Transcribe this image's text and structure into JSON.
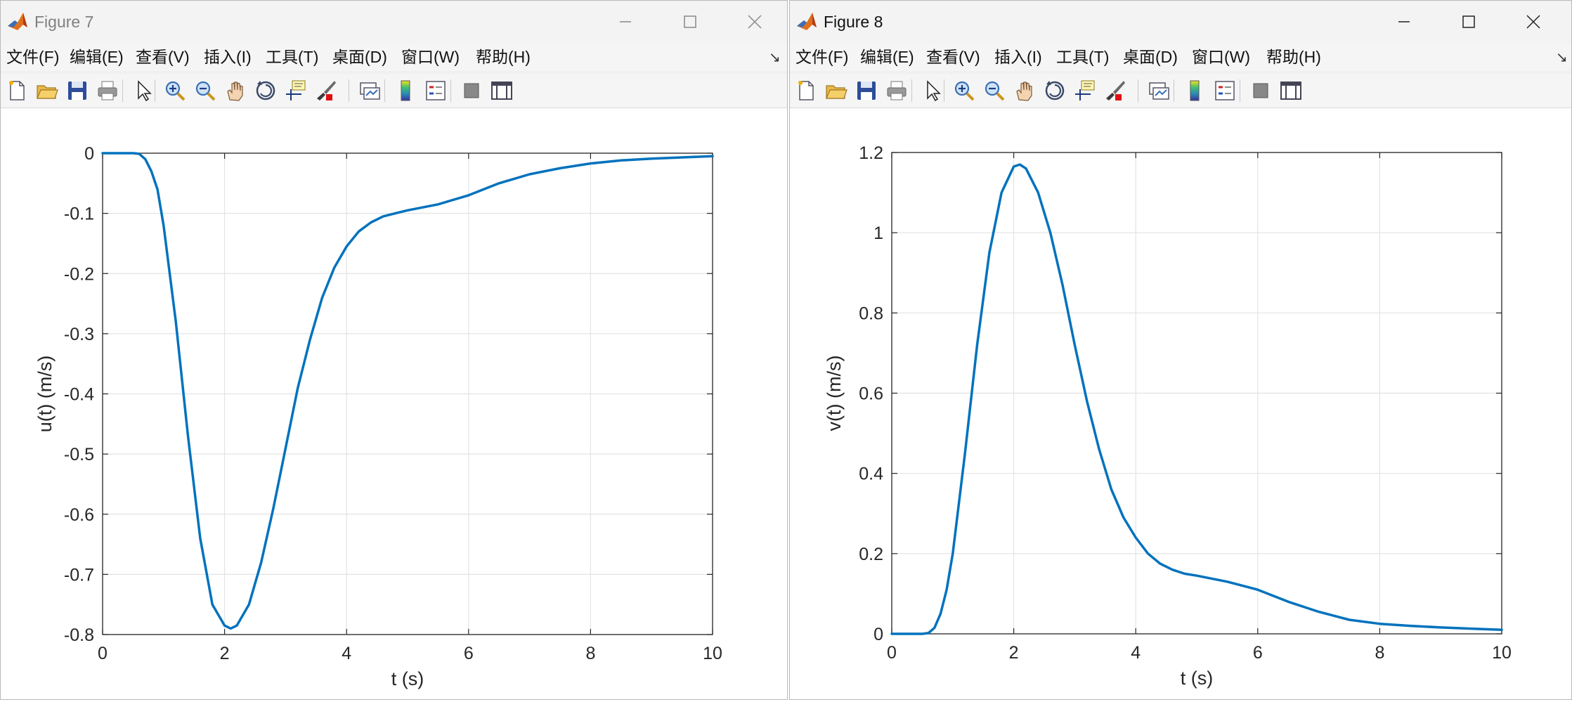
{
  "menu": [
    "文件(F)",
    "编辑(E)",
    "查看(V)",
    "插入(I)",
    "工具(T)",
    "桌面(D)",
    "窗口(W)",
    "帮助(H)"
  ],
  "toolbar_icons": [
    "new-file-icon",
    "open-folder-icon",
    "save-icon",
    "print-icon",
    "pointer-icon",
    "zoom-in-icon",
    "zoom-out-icon",
    "pan-hand-icon",
    "rotate-3d-icon",
    "data-tips-icon",
    "brush-icon",
    "link-plot-icon",
    "colorbar-icon",
    "legend-icon",
    "hide-plot-tools-icon",
    "show-plot-tools-icon"
  ],
  "windows": [
    {
      "title": "Figure 7",
      "active": false,
      "chart_data": {
        "type": "line",
        "xlabel": "t (s)",
        "ylabel": "u(t) (m/s)",
        "xlim": [
          0,
          10
        ],
        "ylim": [
          -0.8,
          0
        ],
        "xticks": [
          "0",
          "2",
          "4",
          "6",
          "8",
          "10"
        ],
        "yticks": [
          "0",
          "-0.1",
          "-0.2",
          "-0.3",
          "-0.4",
          "-0.5",
          "-0.6",
          "-0.7",
          "-0.8"
        ],
        "grid": true,
        "color": "#0072bd",
        "series": [
          {
            "x": [
              0,
              0.5,
              0.6,
              0.7,
              0.8,
              0.9,
              1.0,
              1.2,
              1.4,
              1.6,
              1.8,
              2.0,
              2.1,
              2.2,
              2.4,
              2.6,
              2.8,
              3.0,
              3.2,
              3.4,
              3.6,
              3.8,
              4.0,
              4.2,
              4.4,
              4.6,
              4.8,
              5.0,
              5.5,
              6.0,
              6.5,
              7.0,
              7.5,
              8.0,
              8.5,
              9.0,
              9.5,
              10.0
            ],
            "y": [
              0,
              0,
              -0.001,
              -0.01,
              -0.03,
              -0.06,
              -0.12,
              -0.28,
              -0.47,
              -0.64,
              -0.75,
              -0.785,
              -0.79,
              -0.785,
              -0.75,
              -0.68,
              -0.59,
              -0.49,
              -0.39,
              -0.31,
              -0.24,
              -0.19,
              -0.155,
              -0.13,
              -0.115,
              -0.105,
              -0.1,
              -0.095,
              -0.085,
              -0.07,
              -0.05,
              -0.035,
              -0.025,
              -0.017,
              -0.012,
              -0.009,
              -0.007,
              -0.005
            ]
          }
        ]
      }
    },
    {
      "title": "Figure 8",
      "active": true,
      "chart_data": {
        "type": "line",
        "xlabel": "t (s)",
        "ylabel": "v(t) (m/s)",
        "xlim": [
          0,
          10
        ],
        "ylim": [
          0,
          1.2
        ],
        "xticks": [
          "0",
          "2",
          "4",
          "6",
          "8",
          "10"
        ],
        "yticks": [
          "0",
          "0.2",
          "0.4",
          "0.6",
          "0.8",
          "1",
          "1.2"
        ],
        "grid": true,
        "color": "#0072bd",
        "series": [
          {
            "x": [
              0,
              0.5,
              0.6,
              0.7,
              0.8,
              0.9,
              1.0,
              1.2,
              1.4,
              1.6,
              1.8,
              2.0,
              2.1,
              2.2,
              2.4,
              2.6,
              2.8,
              3.0,
              3.2,
              3.4,
              3.6,
              3.8,
              4.0,
              4.2,
              4.4,
              4.6,
              4.8,
              5.0,
              5.5,
              6.0,
              6.5,
              7.0,
              7.5,
              8.0,
              8.5,
              9.0,
              9.5,
              10.0
            ],
            "y": [
              0,
              0,
              0.002,
              0.015,
              0.05,
              0.11,
              0.2,
              0.45,
              0.72,
              0.95,
              1.1,
              1.165,
              1.17,
              1.16,
              1.1,
              1.0,
              0.87,
              0.72,
              0.58,
              0.46,
              0.36,
              0.29,
              0.24,
              0.2,
              0.175,
              0.16,
              0.15,
              0.145,
              0.13,
              0.11,
              0.08,
              0.055,
              0.035,
              0.025,
              0.02,
              0.016,
              0.013,
              0.01
            ]
          }
        ]
      }
    }
  ]
}
